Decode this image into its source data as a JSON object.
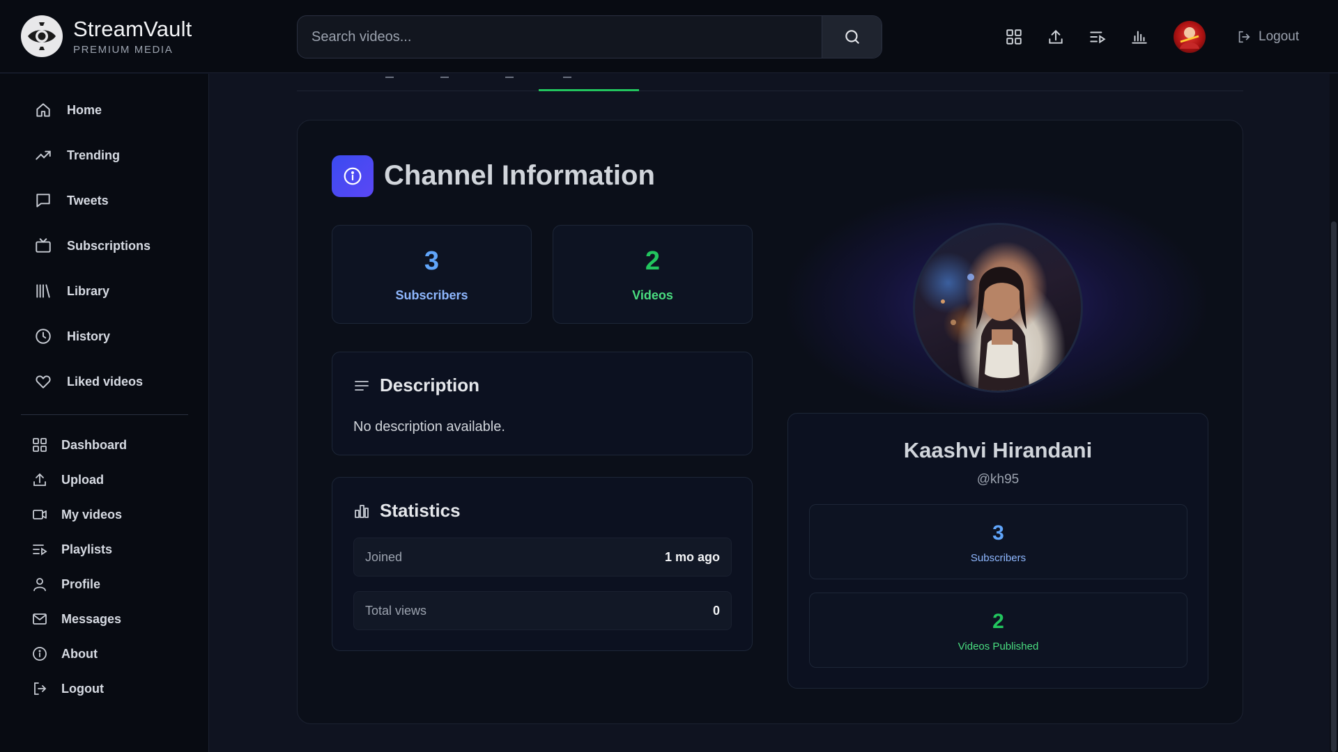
{
  "brand": {
    "name": "StreamVault",
    "subtitle": "PREMIUM MEDIA"
  },
  "search": {
    "placeholder": "Search videos..."
  },
  "header": {
    "logout_label": "Logout"
  },
  "sidebar": {
    "primary": [
      {
        "label": "Home",
        "icon": "home-icon"
      },
      {
        "label": "Trending",
        "icon": "trending-icon"
      },
      {
        "label": "Tweets",
        "icon": "chat-icon"
      },
      {
        "label": "Subscriptions",
        "icon": "tv-icon"
      },
      {
        "label": "Library",
        "icon": "library-icon"
      },
      {
        "label": "History",
        "icon": "clock-icon"
      },
      {
        "label": "Liked videos",
        "icon": "heart-icon"
      }
    ],
    "secondary": [
      {
        "label": "Dashboard",
        "icon": "dashboard-icon"
      },
      {
        "label": "Upload",
        "icon": "upload-icon"
      },
      {
        "label": "My videos",
        "icon": "video-icon"
      },
      {
        "label": "Playlists",
        "icon": "playlist-icon"
      },
      {
        "label": "Profile",
        "icon": "user-icon"
      },
      {
        "label": "Messages",
        "icon": "mail-icon"
      },
      {
        "label": "About",
        "icon": "info-icon"
      },
      {
        "label": "Logout",
        "icon": "logout-icon"
      }
    ]
  },
  "channel_info": {
    "title": "Channel Information",
    "subscribers": {
      "value": "3",
      "label": "Subscribers"
    },
    "videos": {
      "value": "2",
      "label": "Videos"
    },
    "description": {
      "heading": "Description",
      "text": "No description available."
    },
    "statistics": {
      "heading": "Statistics",
      "rows": [
        {
          "key": "Joined",
          "value": "1 mo ago"
        },
        {
          "key": "Total views",
          "value": "0"
        }
      ]
    }
  },
  "profile": {
    "name": "Kaashvi Hirandani",
    "handle": "@kh95",
    "subscribers": {
      "value": "3",
      "label": "Subscribers"
    },
    "videos": {
      "value": "2",
      "label": "Videos Published"
    }
  },
  "colors": {
    "accent_blue": "#60a5fa",
    "accent_green": "#22c55e",
    "badge": "#4b4af2"
  }
}
